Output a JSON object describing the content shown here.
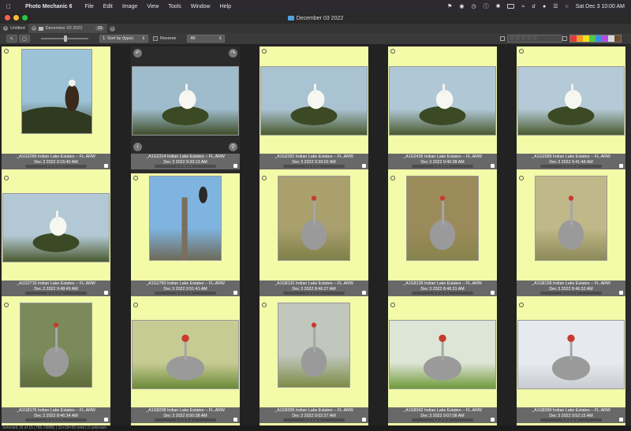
{
  "menubar": {
    "app_name": "Photo Mechanic 6",
    "menus": [
      "File",
      "Edit",
      "Image",
      "View",
      "Tools",
      "Window",
      "Help"
    ],
    "clock": "Sat Dec 3  10:00 AM"
  },
  "window": {
    "title": "December 03 2022"
  },
  "tabs": [
    {
      "label": "Untitled",
      "active": false
    },
    {
      "label": "December 03 2022",
      "active": true,
      "count": "15"
    }
  ],
  "toolbar": {
    "sort_label": "1: Sort by (type)",
    "reverse_label": "Reverse",
    "filter_value": "All",
    "stars": "☆☆☆☆☆",
    "color_classes": [
      "#e23b3b",
      "#f09b2a",
      "#f2e01d",
      "#4fc84a",
      "#3a8fe0",
      "#b24de0",
      "#d8d8d8",
      "#6e4a2e"
    ]
  },
  "status": {
    "text": "Selected 15 of 15 (785.70MB) | 15+15=30 total | 0 unknown"
  },
  "photos": [
    {
      "file": "_A1G2266 Indian Lake Estates -- FL.ARW",
      "date": "Dec 3 2022 9:15:40 AM",
      "subject": "Bald eagle on pine branch",
      "highlight": true
    },
    {
      "file": "_A1G2314 Indian Lake Estates -- FL.ARW",
      "date": "Dec 3 2022 9:33:13 AM",
      "subject": "Great egret on shrub",
      "highlight": false
    },
    {
      "file": "_A1G2391 Indian Lake Estates -- FL.ARW",
      "date": "Dec 3 2022 9:39:02 AM",
      "subject": "Great egret preening",
      "highlight": true
    },
    {
      "file": "_A1G2435 Indian Lake Estates -- FL.ARW",
      "date": "Dec 3 2022 9:40:38 AM",
      "subject": "Great egret preening",
      "highlight": true
    },
    {
      "file": "_A1G2589 Indian Lake Estates -- FL.ARW",
      "date": "Dec 3 2022 9:41:48 AM",
      "subject": "Great egret on shrub",
      "highlight": true
    },
    {
      "file": "_A1G2716 Indian Lake Estates -- FL.ARW",
      "date": "Dec 3 2022 9:48:49 AM",
      "subject": "Great egret wings raised",
      "highlight": true
    },
    {
      "file": "_A1G2760 Indian Lake Estates -- FL.ARW",
      "date": "Dec 3 2022 9:51:41 AM",
      "subject": "Osprey on nest post",
      "highlight": true
    },
    {
      "file": "_A1G8131 Indian Lake Estates -- FL.ARW",
      "date": "Dec 3 2022 8:46:27 AM",
      "subject": "Sandhill crane",
      "highlight": true
    },
    {
      "file": "_A1G8139 Indian Lake Estates -- FL.ARW",
      "date": "Dec 3 2022 8:46:31 AM",
      "subject": "Sandhill crane portrait",
      "highlight": true
    },
    {
      "file": "_A1G8158 Indian Lake Estates -- FL.ARW",
      "date": "Dec 3 2022 8:46:32 AM",
      "subject": "Sandhill crane portrait",
      "highlight": true
    },
    {
      "file": "_A1G8176 Indian Lake Estates -- FL.ARW",
      "date": "Dec 3 2022 8:46:34 AM",
      "subject": "Sandhill crane closeup",
      "highlight": true
    },
    {
      "file": "_A1G8208 Indian Lake Estates -- FL.ARW",
      "date": "Dec 3 2022 8:50:38 AM",
      "subject": "Sandhill crane in field",
      "highlight": true
    },
    {
      "file": "_A1G8305 Indian Lake Estates -- FL.ARW",
      "date": "Dec 3 2022 9:02:27 AM",
      "subject": "Sandhill crane walking",
      "highlight": true
    },
    {
      "file": "_A1G8342 Indian Lake Estates -- FL.ARW",
      "date": "Dec 3 2022 9:07:08 AM",
      "subject": "Sandhill crane feeding",
      "highlight": true
    },
    {
      "file": "_A1G8390 Indian Lake Estates -- FL.ARW",
      "date": "Dec 3 2022 9:52:15 AM",
      "subject": "Sandhill cranes dancing",
      "highlight": true
    }
  ]
}
